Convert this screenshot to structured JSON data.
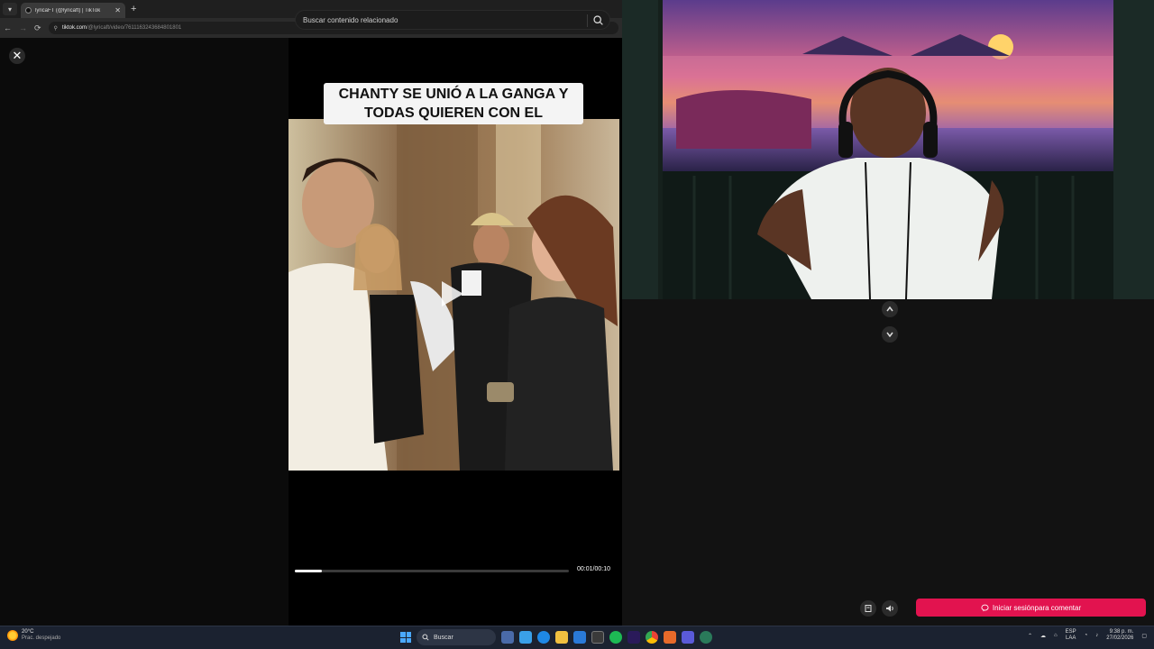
{
  "browser": {
    "tab_title": "lyricaFT (@lyricaft) | TikTok",
    "url_host": "tiktok.com",
    "url_path": "/@lyricaft/video/7611163243684801801"
  },
  "tiktok": {
    "search_placeholder": "Buscar contenido relacionado",
    "caption_line1": "CHANTY SE UNIÓ A LA GANGA Y",
    "caption_line2": "TODAS QUIEREN CON EL",
    "time_display": "00:01/00:10",
    "progress_fraction": 0.1,
    "login_button_label": "Iniciar sesiónpara comentar"
  },
  "taskbar": {
    "weather_temp": "20°C",
    "weather_desc": "Prac. despejado",
    "search_label": "Buscar",
    "lang_top": "ESP",
    "lang_bottom": "LAA",
    "clock_time": "9:38 p. m.",
    "clock_date": "27/02/2026"
  },
  "colors": {
    "accent": "#e2134f",
    "page_bg": "#000000",
    "taskbar_bg": "#1b2230"
  }
}
